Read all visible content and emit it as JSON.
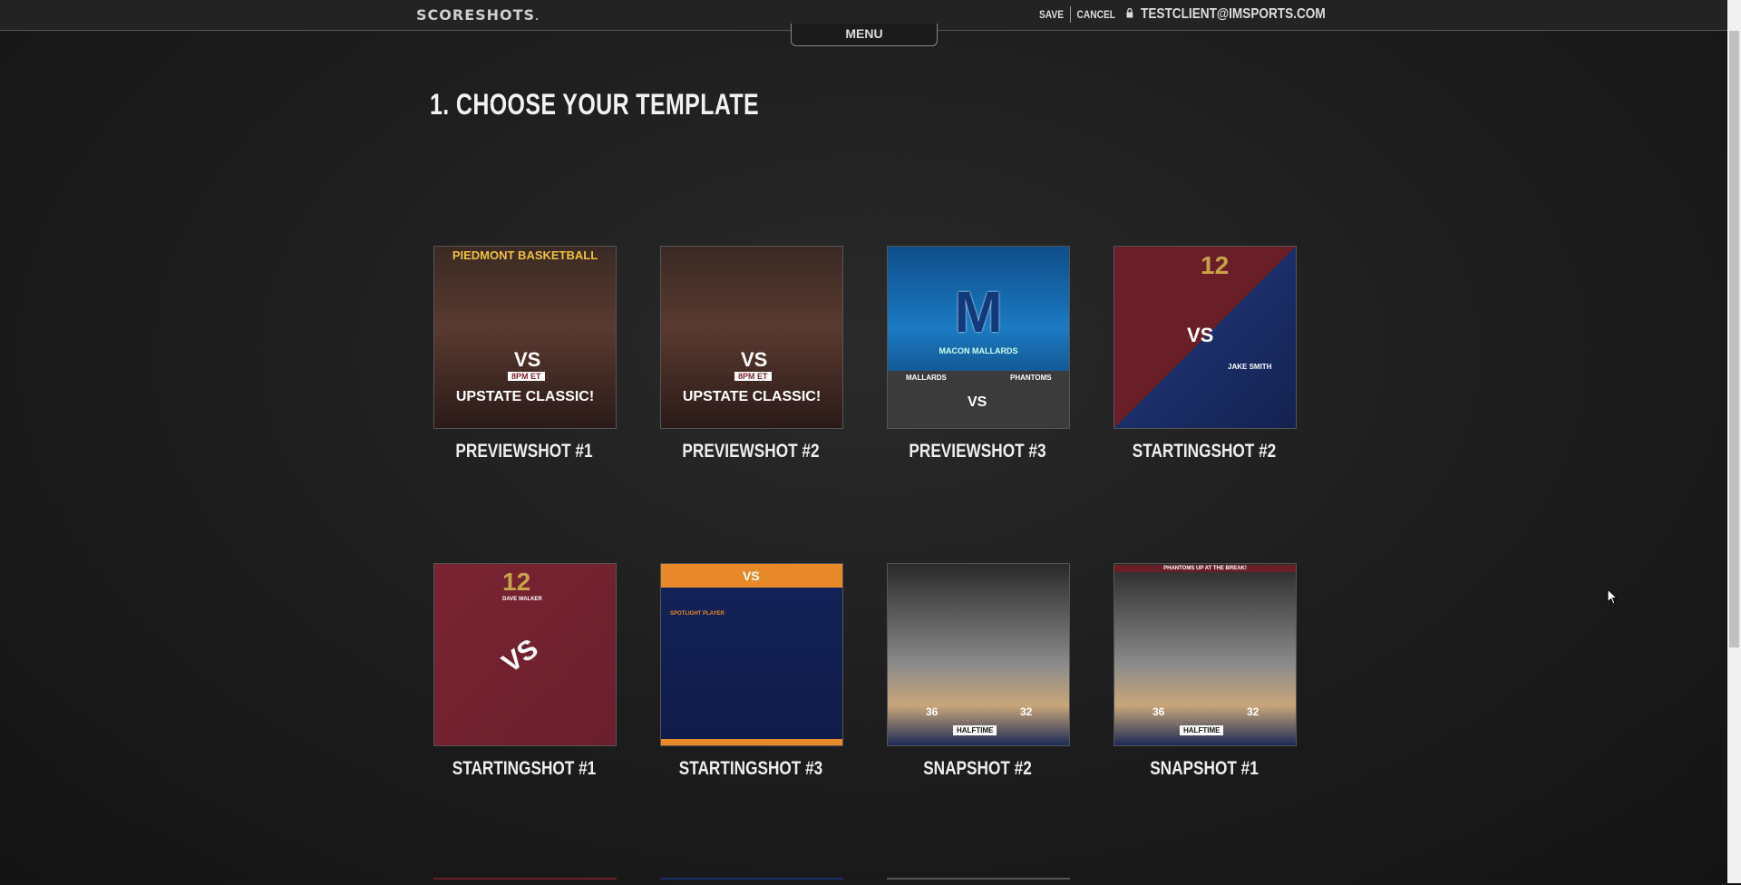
{
  "header": {
    "logo": "SCORESHOTS",
    "save_label": "SAVE",
    "cancel_label": "CANCEL",
    "user_email": "TESTCLIENT@IMSPORTS.COM",
    "menu_label": "MENU"
  },
  "main": {
    "title": "1. CHOOSE YOUR TEMPLATE",
    "templates": [
      {
        "label": "PREVIEWSHOT #1",
        "banner_top": "PIEDMONT BASKETBALL",
        "vs": "VS",
        "time": "8PM ET",
        "headline": "UPSTATE CLASSIC!"
      },
      {
        "label": "PREVIEWSHOT #2",
        "vs": "VS",
        "time": "8PM ET",
        "headline": "UPSTATE CLASSIC!"
      },
      {
        "label": "PREVIEWSHOT #3",
        "team": "MACON MALLARDS",
        "vs": "VS",
        "home": "MALLARDS",
        "away": "PHANTOMS"
      },
      {
        "label": "STARTINGSHOT #2",
        "number": "12",
        "vs": "VS",
        "player": "JAKE SMITH"
      },
      {
        "label": "STARTINGSHOT #1",
        "number": "12",
        "vs": "VS",
        "player": "DAVE WALKER"
      },
      {
        "label": "STARTINGSHOT #3",
        "vs": "VS",
        "spotlight": "SPOTLIGHT PLAYER"
      },
      {
        "label": "SNAPSHOT #2",
        "score_home": "36",
        "score_away": "32",
        "status": "HALFTIME"
      },
      {
        "label": "SNAPSHOT #1",
        "score_home": "36",
        "score_away": "32",
        "status": "HALFTIME",
        "banner_top": "PHANTOMS UP AT THE BREAK!"
      }
    ]
  },
  "icons": {
    "lock": "lock-icon",
    "cursor": "mouse-cursor-icon"
  }
}
